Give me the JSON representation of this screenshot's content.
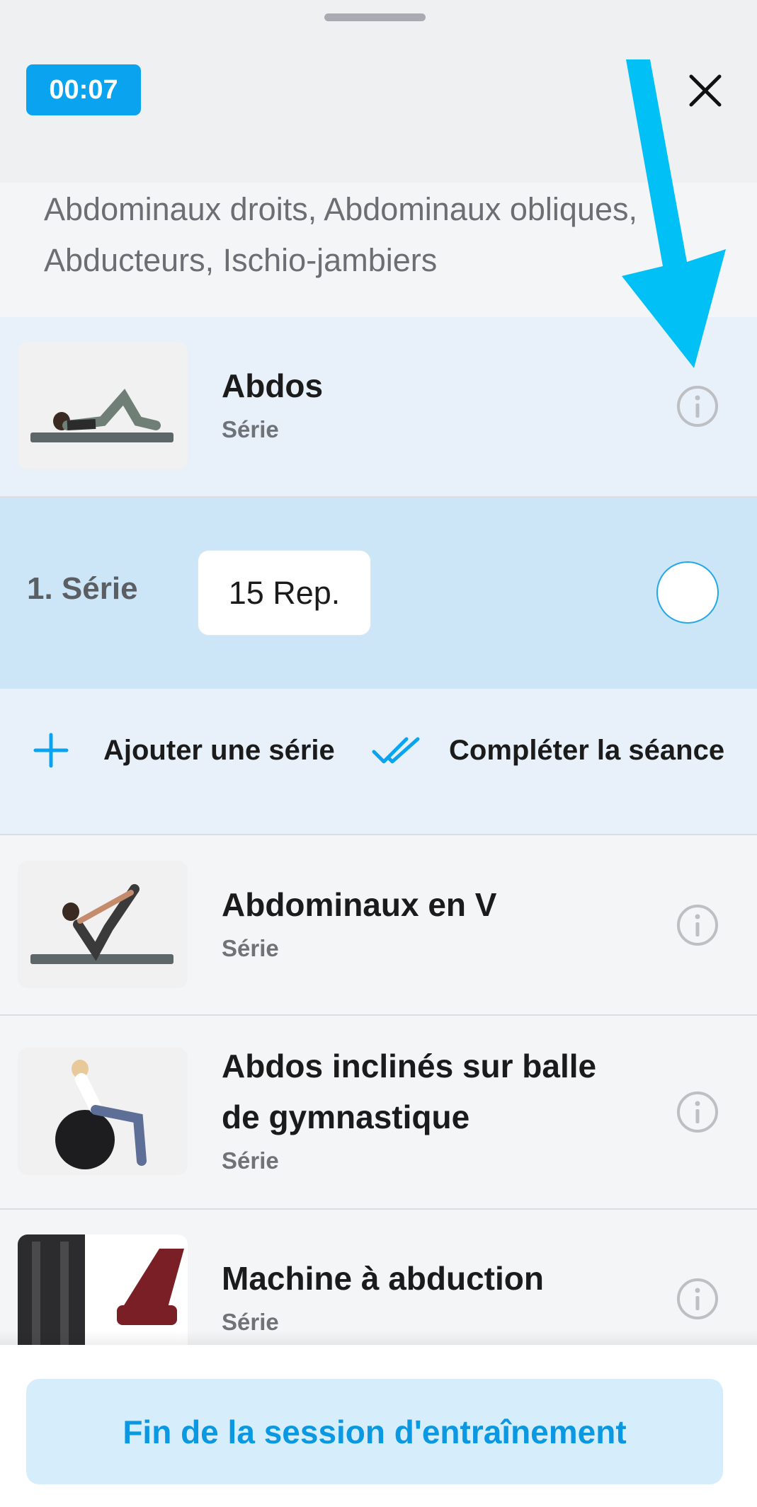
{
  "header": {
    "timer": "00:07",
    "close_icon": "close-icon"
  },
  "muscles_text": "Abdominaux droits, Abdominaux obliques, Abducteurs, Ischio-jambiers",
  "exercises": [
    {
      "name": "Abdos",
      "type": "Série",
      "info_icon": "info-icon"
    },
    {
      "name": "Abdominaux en V",
      "type": "Série",
      "info_icon": "info-icon"
    },
    {
      "name_line1": "Abdos inclinés sur balle",
      "name_line2": "de gymnastique",
      "type": "Série",
      "info_icon": "info-icon"
    },
    {
      "name": "Machine à abduction",
      "type": "Série",
      "info_icon": "info-icon"
    }
  ],
  "active_set": {
    "label": "1. Série",
    "reps": "15 Rep."
  },
  "actions": {
    "add_set": "Ajouter une série",
    "complete_session": "Compléter la séance"
  },
  "footer": {
    "end_button": "Fin de la session d'entraînement"
  },
  "colors": {
    "accent": "#0aa3f0",
    "arrow": "#00c0f5",
    "active_set_bg": "#cce6f7",
    "active_exercise_bg": "#e8f1fa"
  }
}
